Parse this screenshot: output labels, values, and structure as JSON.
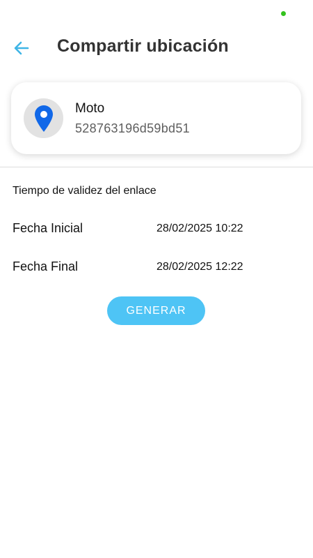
{
  "colors": {
    "accent": "#4ec4f5",
    "back_arrow": "#3fb5e6",
    "pin": "#1168e8",
    "status_dot": "#33c21e",
    "avatar_bg": "#e2e2e2"
  },
  "icons": {
    "back": "arrow-left-icon",
    "avatar": "map-pin-icon"
  },
  "header": {
    "title": "Compartir ubicación"
  },
  "device": {
    "name": "Moto",
    "id": "528763196d59bd51"
  },
  "validity": {
    "label": "Tiempo de validez del enlace",
    "start_label": "Fecha Inicial",
    "start_value": "28/02/2025 10:22",
    "end_label": "Fecha Final",
    "end_value": "28/02/2025 12:22"
  },
  "actions": {
    "generate_label": "GENERAR"
  }
}
